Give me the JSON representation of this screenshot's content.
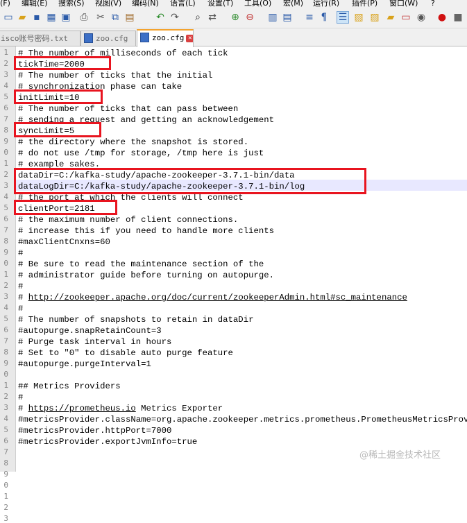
{
  "menu": [
    "(F)",
    "编辑(E)",
    "搜索(S)",
    "视图(V)",
    "编码(N)",
    "语言(L)",
    "设置(T)",
    "工具(O)",
    "宏(M)",
    "运行(R)",
    "插件(P)",
    "窗口(W)",
    "?"
  ],
  "toolbar_icons": [
    "new-file-icon",
    "open-icon",
    "save-icon",
    "save-all-icon",
    "close-icon",
    "close-all-icon",
    "print-icon",
    "cut-icon",
    "copy-icon",
    "paste-icon",
    "undo-icon",
    "redo-icon",
    "find-icon",
    "replace-icon",
    "zoom-in-icon",
    "zoom-out-icon",
    "sync-v-icon",
    "sync-h-icon",
    "wrap-icon",
    "show-all-chars-icon",
    "indent-guide-icon",
    "doc-map-icon",
    "function-list-icon",
    "folder-icon",
    "monitor-icon",
    "record-icon",
    "stop-icon"
  ],
  "tabs": [
    {
      "label": "isco账号密码.txt",
      "active": false
    },
    {
      "label": "zoo.cfg",
      "active": false
    },
    {
      "label": "zoo.cfg",
      "active": true
    }
  ],
  "line_numbers": [
    "1",
    "2",
    "3",
    "4",
    "5",
    "6",
    "7",
    "8",
    "9",
    "0",
    "1",
    "2",
    "3",
    "4",
    "5",
    "6",
    "7",
    "8",
    "9",
    "0",
    "1",
    "2",
    "3",
    "4",
    "5",
    "6",
    "7",
    "8",
    "9",
    "0",
    "1",
    "2",
    "3",
    "4",
    "5",
    "6",
    "7",
    "8",
    "9",
    "0",
    "1",
    "2",
    "3"
  ],
  "lines": [
    "# The number of milliseconds of each tick",
    "tickTime=2000",
    "# The number of ticks that the initial",
    "# synchronization phase can take",
    "initLimit=10",
    "# The number of ticks that can pass between",
    "# sending a request and getting an acknowledgement",
    "syncLimit=5",
    "# the directory where the snapshot is stored.",
    "# do not use /tmp for storage, /tmp here is just",
    "# example sakes.",
    "dataDir=C:/kafka-study/apache-zookeeper-3.7.1-bin/data",
    "dataLogDir=C:/kafka-study/apache-zookeeper-3.7.1-bin/log",
    "# the port at which the clients will connect",
    "clientPort=2181",
    "# the maximum number of client connections.",
    "# increase this if you need to handle more clients",
    "#maxClientCnxns=60",
    "#",
    "# Be sure to read the maintenance section of the",
    "# administrator guide before turning on autopurge.",
    "#",
    "# http://zookeeper.apache.org/doc/current/zookeeperAdmin.html#sc_maintenance",
    "#",
    "# The number of snapshots to retain in dataDir",
    "#autopurge.snapRetainCount=3",
    "# Purge task interval in hours",
    "# Set to \"0\" to disable auto purge feature",
    "#autopurge.purgeInterval=1",
    "",
    "## Metrics Providers",
    "#",
    "# https://prometheus.io Metrics Exporter",
    "#metricsProvider.className=org.apache.zookeeper.metrics.prometheus.PrometheusMetricsProvider",
    "#metricsProvider.httpPort=7000",
    "#metricsProvider.exportJvmInfo=true",
    "",
    "",
    "",
    "",
    "",
    "",
    ""
  ],
  "watermark": "@稀土掘金技术社区"
}
